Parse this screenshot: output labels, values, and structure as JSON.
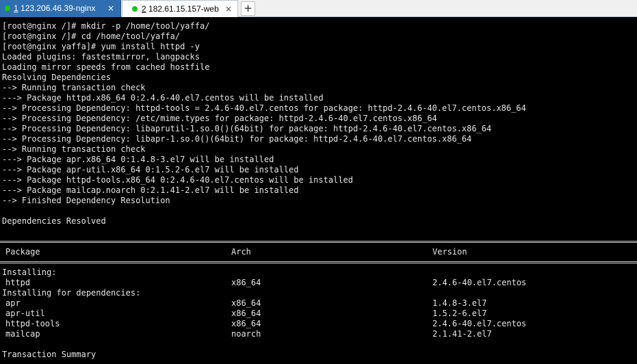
{
  "colors": {
    "terminal_bg": "#000000",
    "terminal_fg": "#e6e6e6",
    "active_tab_bg": "#2f6fb1",
    "status_dot": "#18c418"
  },
  "tabs": [
    {
      "number": "1",
      "label": "123.206.46.39-nginx",
      "close": "×",
      "status": "connected"
    },
    {
      "number": "2",
      "label": "182.61.15.157-web",
      "close": "×",
      "status": "connected"
    }
  ],
  "new_tab_label": "+",
  "terminal": {
    "lines": [
      "[root@nginx /]# mkdir -p /home/tool/yaffa/",
      "[root@nginx /]# cd /home/tool/yaffa/",
      "[root@nginx yaffa]# yum install httpd -y",
      "Loaded plugins: fastestmirror, langpacks",
      "Loading mirror speeds from cached hostfile",
      "Resolving Dependencies",
      "--> Running transaction check",
      "---> Package httpd.x86_64 0:2.4.6-40.el7.centos will be installed",
      "--> Processing Dependency: httpd-tools = 2.4.6-40.el7.centos for package: httpd-2.4.6-40.el7.centos.x86_64",
      "--> Processing Dependency: /etc/mime.types for package: httpd-2.4.6-40.el7.centos.x86_64",
      "--> Processing Dependency: libaprutil-1.so.0()(64bit) for package: httpd-2.4.6-40.el7.centos.x86_64",
      "--> Processing Dependency: libapr-1.so.0()(64bit) for package: httpd-2.4.6-40.el7.centos.x86_64",
      "--> Running transaction check",
      "---> Package apr.x86_64 0:1.4.8-3.el7 will be installed",
      "---> Package apr-util.x86_64 0:1.5.2-6.el7 will be installed",
      "---> Package httpd-tools.x86_64 0:2.4.6-40.el7.centos will be installed",
      "---> Package mailcap.noarch 0:2.1.41-2.el7 will be installed",
      "--> Finished Dependency Resolution",
      "",
      "Dependencies Resolved",
      ""
    ],
    "table": {
      "headers": {
        "package": "Package",
        "arch": "Arch",
        "version": "Version"
      },
      "installing_label": "Installing:",
      "installing": [
        {
          "package": "httpd",
          "arch": "x86_64",
          "version": "2.4.6-40.el7.centos"
        }
      ],
      "deps_label": "Installing for dependencies:",
      "deps": [
        {
          "package": "apr",
          "arch": "x86_64",
          "version": "1.4.8-3.el7"
        },
        {
          "package": "apr-util",
          "arch": "x86_64",
          "version": "1.5.2-6.el7"
        },
        {
          "package": "httpd-tools",
          "arch": "x86_64",
          "version": "2.4.6-40.el7.centos"
        },
        {
          "package": "mailcap",
          "arch": "noarch",
          "version": "2.1.41-2.el7"
        }
      ]
    },
    "summary": "Transaction Summary"
  }
}
